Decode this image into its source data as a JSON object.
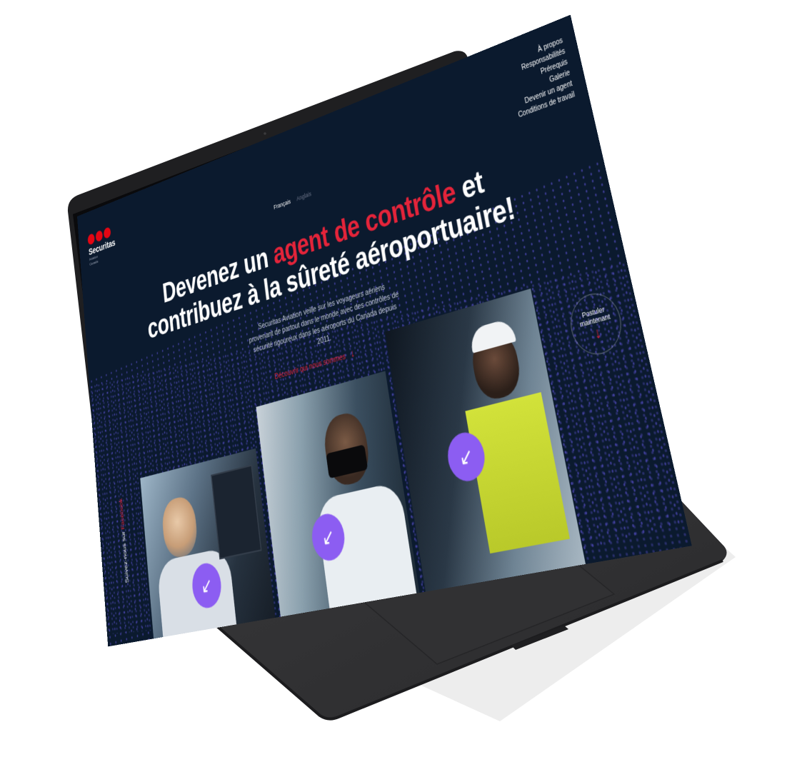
{
  "logo": {
    "name": "Securitas",
    "sub_line1": "Aviation",
    "sub_line2": "Canada"
  },
  "nav": {
    "items": [
      "À propos",
      "Responsabilités",
      "Prérequis",
      "Galerie",
      "Devenir un agent",
      "Conditions de travail"
    ]
  },
  "languages": {
    "active": "Français",
    "inactive": "Anglais"
  },
  "hero": {
    "title_part1": "Devenez un ",
    "title_accent": "agent de contrôle",
    "title_part2": " et contribuez à la sûreté aéroportuaire!",
    "description": "Securitas Aviation veille sur les voyageurs aériens provenant de partout dans le monde avec des contrôles de sécurité rigoureux dans les aéroports du Canada depuis 2011.",
    "cta_label": "Découvrir qui nous sommes",
    "cta_icon": "arrow-down-icon"
  },
  "photos": [
    {
      "icon": "arrow-down-left-icon",
      "glyph": "↙"
    },
    {
      "icon": "arrow-down-left-icon",
      "glyph": "↙"
    },
    {
      "icon": "arrow-down-left-icon",
      "glyph": "↙"
    }
  ],
  "side_text": {
    "prefix": "Suivez-nous sur",
    "link": "Facebook"
  },
  "scroll_badge": {
    "label": "Postuler maintenant",
    "icon": "arrow-down-icon"
  },
  "colors": {
    "accent_red": "#e4243a",
    "brand_red": "#e30613",
    "accent_purple": "#8c5df2",
    "screen_bg": "#0b1a2e"
  }
}
